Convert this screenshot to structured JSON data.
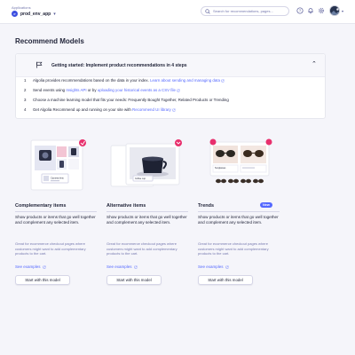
{
  "topbar": {
    "app_label": "Applications",
    "app_name": "prod_env_app",
    "app_initials": "P",
    "search_placeholder": "Search for recommendations, pages..."
  },
  "page": {
    "title": "Recommend Models"
  },
  "getting_started": {
    "title": "Getting started: Implement product recommendations in 4 steps",
    "steps": [
      {
        "num": "1",
        "text": "Algolia provides recommendations based on the data in your index.",
        "link": "Learn about sending and managing data"
      },
      {
        "num": "2",
        "pre": "Send events using",
        "link1": "Insights API",
        "mid": "or by",
        "link2": "uploading your historical events as a CSV file"
      },
      {
        "num": "3",
        "text": "Choose a machine learning model that fits your needs: Frequently Bought Together, Related Products or Trending"
      },
      {
        "num": "4",
        "pre": "Get Algolia Recommend up and running on your site with",
        "link": "Recommend UI library"
      }
    ]
  },
  "cards": [
    {
      "title": "Complementary items",
      "badge": "",
      "description": "Show products or items that go well together and complement any selected item.",
      "note": "Great for ecommerce checkout pages where customers might want to add complementary products to the cart.",
      "see_examples": "See examples",
      "button": "Start with this model",
      "image_caption": "Camera lens"
    },
    {
      "title": "Alternative items",
      "badge": "",
      "description": "Show products or items that go well together and complement any selected item.",
      "note": "Great for ecommerce checkout pages where customers might want to add complementary products to the cart.",
      "see_examples": "See examples",
      "button": "Start with this model",
      "image_caption": "Coffee cup"
    },
    {
      "title": "Trends",
      "badge": "New",
      "description": "Show products or items that go well together and complement any selected item.",
      "note": "Great for ecommerce checkout pages where customers might want to add complementary products to the cart.",
      "see_examples": "See examples",
      "button": "Start with this model",
      "image_caption": "Sunglasses"
    }
  ],
  "colors": {
    "accent": "#5468ff",
    "pink": "#e8306d",
    "text": "#23263b",
    "muted": "#777aaf"
  }
}
